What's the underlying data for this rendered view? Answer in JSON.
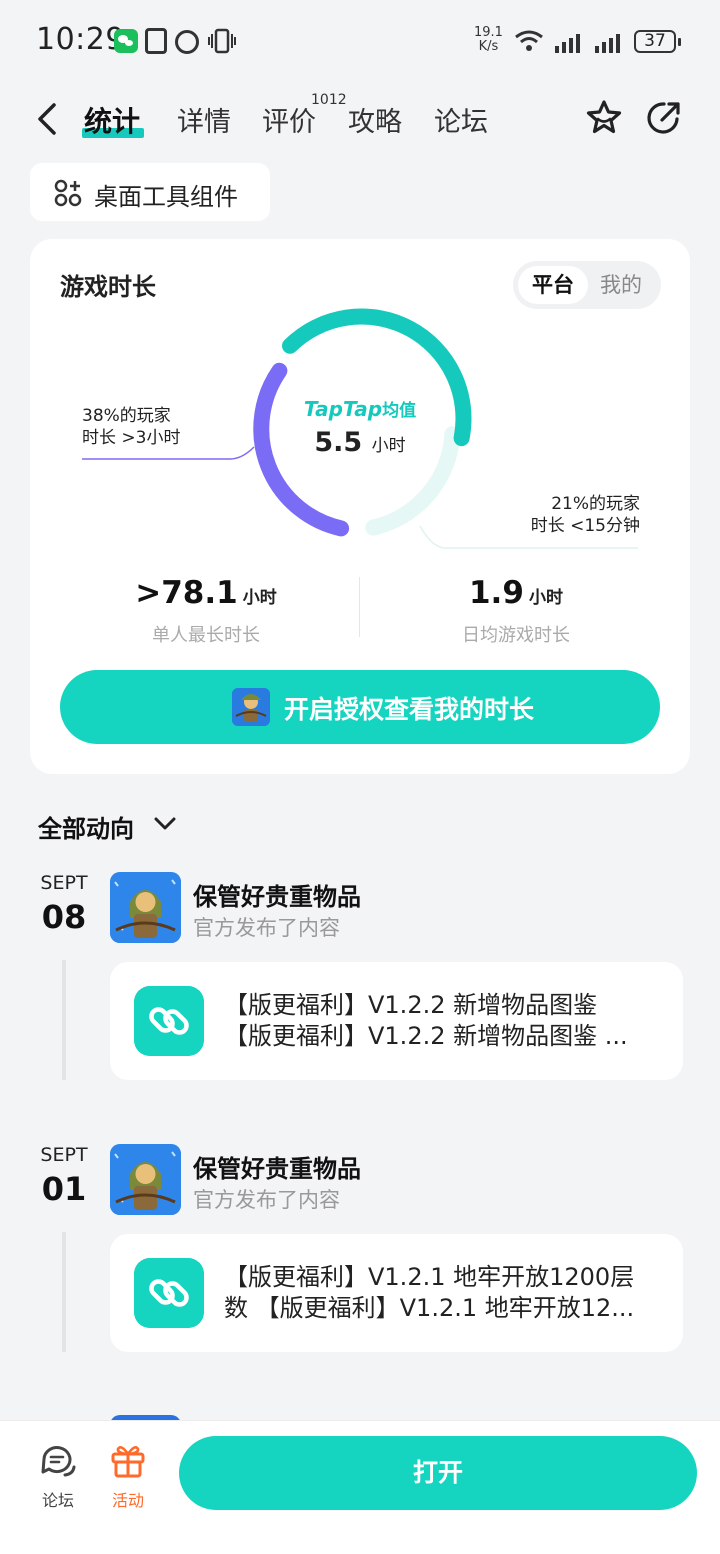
{
  "status_bar": {
    "time": "10:29",
    "net_speed_value": "19.1",
    "net_speed_unit": "K/s",
    "battery": "37"
  },
  "nav": {
    "tabs": [
      {
        "label": "统计"
      },
      {
        "label": "详情"
      },
      {
        "label": "评价"
      },
      {
        "label": "攻略"
      },
      {
        "label": "论坛"
      }
    ],
    "review_count": "1012"
  },
  "widget_chip": {
    "label": "桌面工具组件"
  },
  "stats": {
    "title": "游戏时长",
    "segment": {
      "platform": "平台",
      "mine": "我的"
    },
    "center_brand": "TapTap",
    "center_brand_suffix": "均值",
    "center_value": "5.5",
    "center_unit": "小时",
    "note_left_line1": "38%的玩家",
    "note_left_line2": "时长 >3小时",
    "note_right_line1": "21%的玩家",
    "note_right_line2": "时长 <15分钟",
    "max_value": ">78.1",
    "max_unit": "小时",
    "max_caption": "单人最长时长",
    "daily_value": "1.9",
    "daily_unit": "小时",
    "daily_caption": "日均游戏时长",
    "auth_button": "开启授权查看我的时长"
  },
  "feed": {
    "filter_label": "全部动向",
    "posts": [
      {
        "month": "SEPT",
        "day": "08",
        "title": "保管好贵重物品",
        "subtitle": "官方发布了内容",
        "line1": "【版更福利】V1.2.2 新增物品图鉴",
        "line2": "【版更福利】V1.2.2 新增物品图鉴 ..."
      },
      {
        "month": "SEPT",
        "day": "01",
        "title": "保管好贵重物品",
        "subtitle": "官方发布了内容",
        "line1": "【版更福利】V1.2.1 地牢开放1200层",
        "line2": "数 【版更福利】V1.2.1 地牢开放12..."
      }
    ]
  },
  "bottom_bar": {
    "forum": "论坛",
    "activity": "活动",
    "open": "打开"
  },
  "colors": {
    "accent": "#15d4c0",
    "purple": "#7b6cf6",
    "activity": "#ff6a2b"
  }
}
